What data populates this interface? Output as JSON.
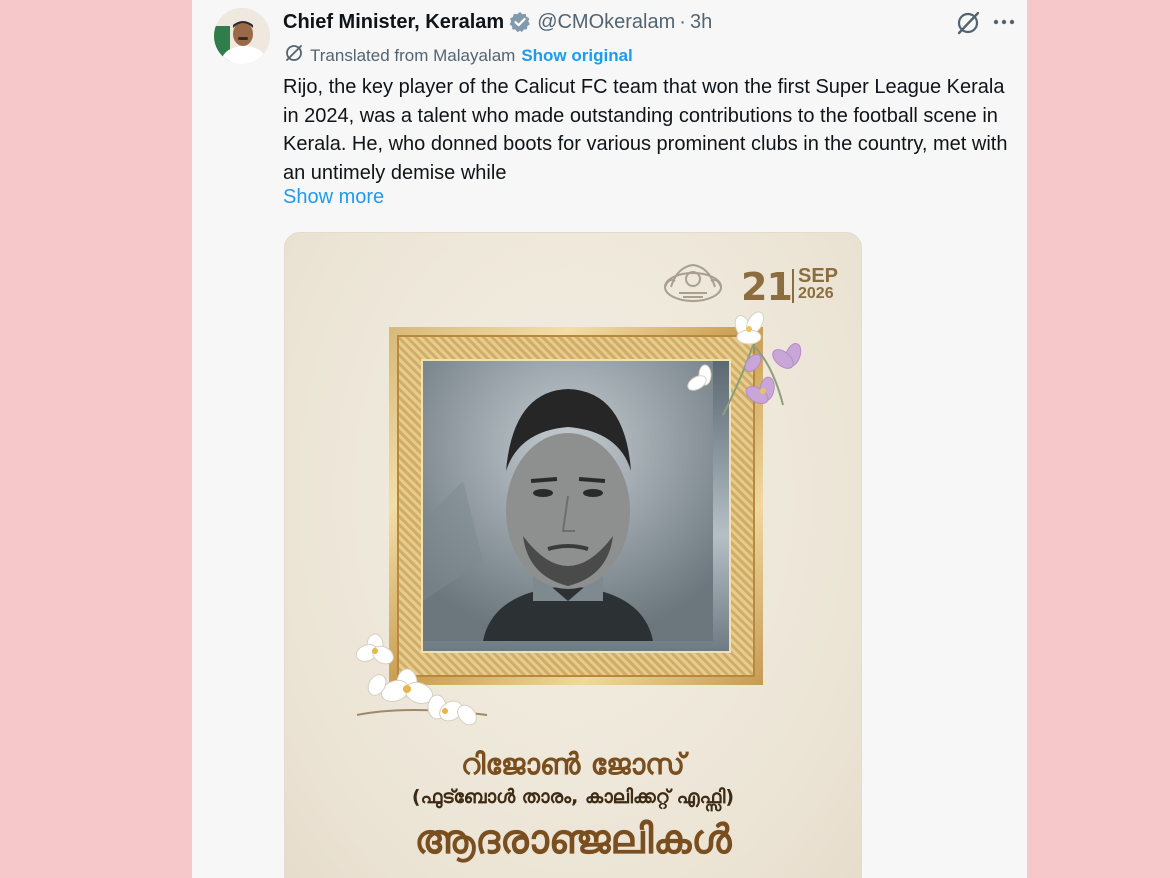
{
  "tweet": {
    "display_name": "Chief Minister, Keralam",
    "handle": "@CMOkeralam",
    "separator": "·",
    "time": "3h",
    "translated_label": "Translated from Malayalam",
    "show_original": "Show original",
    "text": "Rijo, the key player of the Calicut FC team that won the first Super League Kerala in 2024, was a talent who made outstanding contributions to the football scene in Kerala. He, who donned boots for various prominent clubs in the country, met with an untimely demise while",
    "show_more": "Show more"
  },
  "poster": {
    "date_day": "21",
    "date_month": "SEP",
    "date_year": "2026",
    "name_ml": "റിജോൺ ജോസ്",
    "subtitle_ml": "(ഫുട്ബോൾ താരം, കാലിക്കറ്റ് എഫ്സി)",
    "tribute_ml": "ആദരാഞ്ജലികൾ"
  },
  "icons": {
    "verified": "verified-badge-icon",
    "grok": "grok-icon",
    "more": "more-options-icon",
    "translate": "translate-icon"
  },
  "colors": {
    "accent": "#1d9bf0",
    "background": "#f7c8c9",
    "gold": "#8b6d3f"
  }
}
